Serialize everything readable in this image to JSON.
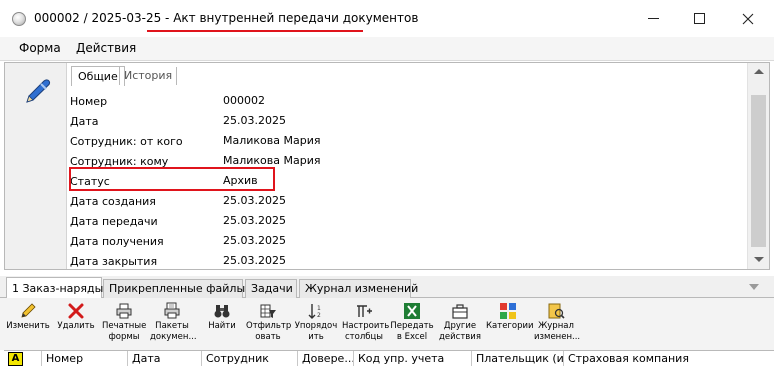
{
  "window": {
    "title_prefix": "000002 / 2025-03-25 - ",
    "title_main": "Акт внутренней передачи документов"
  },
  "menu": {
    "forma": "Форма",
    "actions": "Действия"
  },
  "top_tabs": {
    "general": "Общие",
    "history": "История"
  },
  "fields": [
    {
      "label": "Номер",
      "value": "000002"
    },
    {
      "label": "Дата",
      "value": "25.03.2025"
    },
    {
      "label": "Сотрудник: от кого",
      "value": "Маликова Мария"
    },
    {
      "label": "Сотрудник: кому",
      "value": "Маликова Мария"
    },
    {
      "label": "Статус",
      "value": "Архив"
    },
    {
      "label": "Дата создания",
      "value": "25.03.2025"
    },
    {
      "label": "Дата передачи",
      "value": "25.03.2025"
    },
    {
      "label": "Дата получения",
      "value": "25.03.2025"
    },
    {
      "label": "Дата закрытия",
      "value": "25.03.2025"
    }
  ],
  "bottom_tabs": [
    "1 Заказ-наряды",
    "Прикрепленные файлы",
    "Задачи",
    "Журнал изменений"
  ],
  "toolbar": [
    {
      "label": "Изменить",
      "icon": "pencil-icon"
    },
    {
      "label": "Удалить",
      "icon": "delete-icon"
    },
    {
      "label": "Печатные\nформы",
      "icon": "printer-icon"
    },
    {
      "label": "Пакеты\nдокумен...",
      "icon": "printer-pack-icon"
    },
    {
      "label": "Найти",
      "icon": "binoculars-icon"
    },
    {
      "label": "Отфильтр\nовать",
      "icon": "filter-icon"
    },
    {
      "label": "Упорядоч\nить",
      "icon": "sort-icon"
    },
    {
      "label": "Настроить\nстолбцы",
      "icon": "columns-icon"
    },
    {
      "label": "Передать\nв Excel",
      "icon": "excel-icon"
    },
    {
      "label": "Другие\nдействия",
      "icon": "briefcase-icon"
    },
    {
      "label": "Категории",
      "icon": "categories-icon"
    },
    {
      "label": "Журнал\nизменен...",
      "icon": "journal-icon"
    }
  ],
  "grid_columns": [
    "Номер",
    "Дата",
    "Сотрудник",
    "Довере...",
    "Код упр. учета",
    "Плательщик  (и...",
    "Страховая компания"
  ],
  "colors": {
    "highlight": "#e0141c",
    "excel_green": "#1e7d34"
  }
}
